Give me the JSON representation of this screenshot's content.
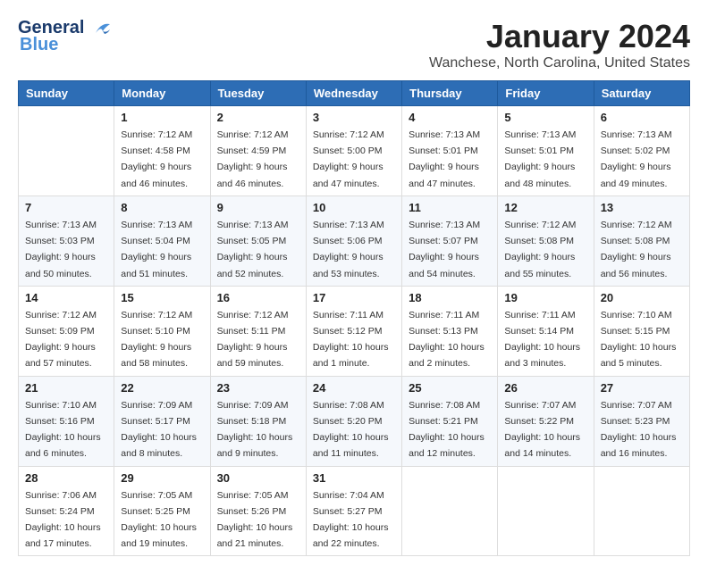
{
  "header": {
    "logo_line1": "General",
    "logo_line2": "Blue",
    "month_title": "January 2024",
    "location": "Wanchese, North Carolina, United States"
  },
  "days_of_week": [
    "Sunday",
    "Monday",
    "Tuesday",
    "Wednesday",
    "Thursday",
    "Friday",
    "Saturday"
  ],
  "weeks": [
    [
      {
        "day": "",
        "sunrise": "",
        "sunset": "",
        "daylight": ""
      },
      {
        "day": "1",
        "sunrise": "Sunrise: 7:12 AM",
        "sunset": "Sunset: 4:58 PM",
        "daylight": "Daylight: 9 hours and 46 minutes."
      },
      {
        "day": "2",
        "sunrise": "Sunrise: 7:12 AM",
        "sunset": "Sunset: 4:59 PM",
        "daylight": "Daylight: 9 hours and 46 minutes."
      },
      {
        "day": "3",
        "sunrise": "Sunrise: 7:12 AM",
        "sunset": "Sunset: 5:00 PM",
        "daylight": "Daylight: 9 hours and 47 minutes."
      },
      {
        "day": "4",
        "sunrise": "Sunrise: 7:13 AM",
        "sunset": "Sunset: 5:01 PM",
        "daylight": "Daylight: 9 hours and 47 minutes."
      },
      {
        "day": "5",
        "sunrise": "Sunrise: 7:13 AM",
        "sunset": "Sunset: 5:01 PM",
        "daylight": "Daylight: 9 hours and 48 minutes."
      },
      {
        "day": "6",
        "sunrise": "Sunrise: 7:13 AM",
        "sunset": "Sunset: 5:02 PM",
        "daylight": "Daylight: 9 hours and 49 minutes."
      }
    ],
    [
      {
        "day": "7",
        "sunrise": "Sunrise: 7:13 AM",
        "sunset": "Sunset: 5:03 PM",
        "daylight": "Daylight: 9 hours and 50 minutes."
      },
      {
        "day": "8",
        "sunrise": "Sunrise: 7:13 AM",
        "sunset": "Sunset: 5:04 PM",
        "daylight": "Daylight: 9 hours and 51 minutes."
      },
      {
        "day": "9",
        "sunrise": "Sunrise: 7:13 AM",
        "sunset": "Sunset: 5:05 PM",
        "daylight": "Daylight: 9 hours and 52 minutes."
      },
      {
        "day": "10",
        "sunrise": "Sunrise: 7:13 AM",
        "sunset": "Sunset: 5:06 PM",
        "daylight": "Daylight: 9 hours and 53 minutes."
      },
      {
        "day": "11",
        "sunrise": "Sunrise: 7:13 AM",
        "sunset": "Sunset: 5:07 PM",
        "daylight": "Daylight: 9 hours and 54 minutes."
      },
      {
        "day": "12",
        "sunrise": "Sunrise: 7:12 AM",
        "sunset": "Sunset: 5:08 PM",
        "daylight": "Daylight: 9 hours and 55 minutes."
      },
      {
        "day": "13",
        "sunrise": "Sunrise: 7:12 AM",
        "sunset": "Sunset: 5:08 PM",
        "daylight": "Daylight: 9 hours and 56 minutes."
      }
    ],
    [
      {
        "day": "14",
        "sunrise": "Sunrise: 7:12 AM",
        "sunset": "Sunset: 5:09 PM",
        "daylight": "Daylight: 9 hours and 57 minutes."
      },
      {
        "day": "15",
        "sunrise": "Sunrise: 7:12 AM",
        "sunset": "Sunset: 5:10 PM",
        "daylight": "Daylight: 9 hours and 58 minutes."
      },
      {
        "day": "16",
        "sunrise": "Sunrise: 7:12 AM",
        "sunset": "Sunset: 5:11 PM",
        "daylight": "Daylight: 9 hours and 59 minutes."
      },
      {
        "day": "17",
        "sunrise": "Sunrise: 7:11 AM",
        "sunset": "Sunset: 5:12 PM",
        "daylight": "Daylight: 10 hours and 1 minute."
      },
      {
        "day": "18",
        "sunrise": "Sunrise: 7:11 AM",
        "sunset": "Sunset: 5:13 PM",
        "daylight": "Daylight: 10 hours and 2 minutes."
      },
      {
        "day": "19",
        "sunrise": "Sunrise: 7:11 AM",
        "sunset": "Sunset: 5:14 PM",
        "daylight": "Daylight: 10 hours and 3 minutes."
      },
      {
        "day": "20",
        "sunrise": "Sunrise: 7:10 AM",
        "sunset": "Sunset: 5:15 PM",
        "daylight": "Daylight: 10 hours and 5 minutes."
      }
    ],
    [
      {
        "day": "21",
        "sunrise": "Sunrise: 7:10 AM",
        "sunset": "Sunset: 5:16 PM",
        "daylight": "Daylight: 10 hours and 6 minutes."
      },
      {
        "day": "22",
        "sunrise": "Sunrise: 7:09 AM",
        "sunset": "Sunset: 5:17 PM",
        "daylight": "Daylight: 10 hours and 8 minutes."
      },
      {
        "day": "23",
        "sunrise": "Sunrise: 7:09 AM",
        "sunset": "Sunset: 5:18 PM",
        "daylight": "Daylight: 10 hours and 9 minutes."
      },
      {
        "day": "24",
        "sunrise": "Sunrise: 7:08 AM",
        "sunset": "Sunset: 5:20 PM",
        "daylight": "Daylight: 10 hours and 11 minutes."
      },
      {
        "day": "25",
        "sunrise": "Sunrise: 7:08 AM",
        "sunset": "Sunset: 5:21 PM",
        "daylight": "Daylight: 10 hours and 12 minutes."
      },
      {
        "day": "26",
        "sunrise": "Sunrise: 7:07 AM",
        "sunset": "Sunset: 5:22 PM",
        "daylight": "Daylight: 10 hours and 14 minutes."
      },
      {
        "day": "27",
        "sunrise": "Sunrise: 7:07 AM",
        "sunset": "Sunset: 5:23 PM",
        "daylight": "Daylight: 10 hours and 16 minutes."
      }
    ],
    [
      {
        "day": "28",
        "sunrise": "Sunrise: 7:06 AM",
        "sunset": "Sunset: 5:24 PM",
        "daylight": "Daylight: 10 hours and 17 minutes."
      },
      {
        "day": "29",
        "sunrise": "Sunrise: 7:05 AM",
        "sunset": "Sunset: 5:25 PM",
        "daylight": "Daylight: 10 hours and 19 minutes."
      },
      {
        "day": "30",
        "sunrise": "Sunrise: 7:05 AM",
        "sunset": "Sunset: 5:26 PM",
        "daylight": "Daylight: 10 hours and 21 minutes."
      },
      {
        "day": "31",
        "sunrise": "Sunrise: 7:04 AM",
        "sunset": "Sunset: 5:27 PM",
        "daylight": "Daylight: 10 hours and 22 minutes."
      },
      {
        "day": "",
        "sunrise": "",
        "sunset": "",
        "daylight": ""
      },
      {
        "day": "",
        "sunrise": "",
        "sunset": "",
        "daylight": ""
      },
      {
        "day": "",
        "sunrise": "",
        "sunset": "",
        "daylight": ""
      }
    ]
  ]
}
